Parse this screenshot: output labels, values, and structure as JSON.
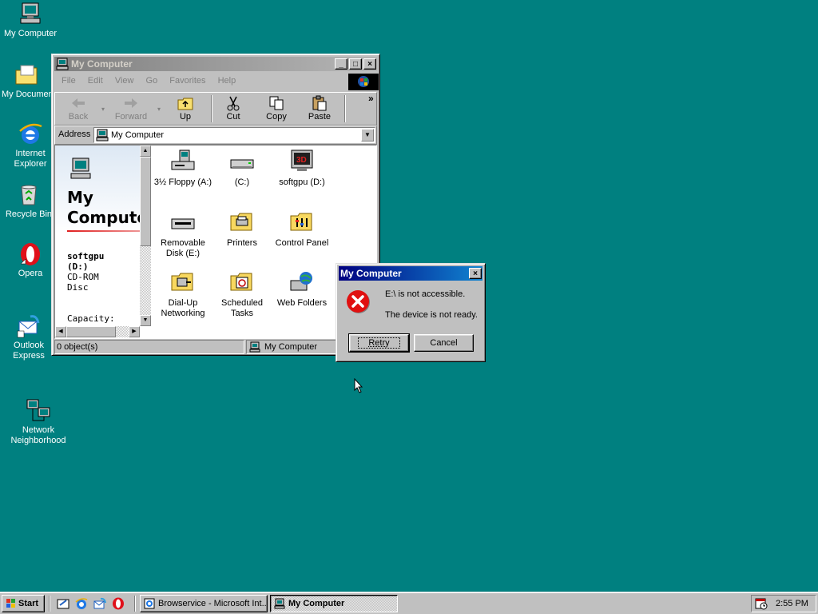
{
  "desktop": {
    "icons": [
      {
        "label": "My Computer"
      },
      {
        "label": "My Documents"
      },
      {
        "label": "Internet Explorer"
      },
      {
        "label": "Recycle Bin"
      },
      {
        "label": "Opera"
      },
      {
        "label": "Outlook Express"
      },
      {
        "label": "Network Neighborhood"
      }
    ]
  },
  "explorer": {
    "title": "My Computer",
    "menu": [
      "File",
      "Edit",
      "View",
      "Go",
      "Favorites",
      "Help"
    ],
    "toolbar": {
      "back": "Back",
      "forward": "Forward",
      "up": "Up",
      "cut": "Cut",
      "copy": "Copy",
      "paste": "Paste",
      "more": "»"
    },
    "address": {
      "label": "Address",
      "value": "My Computer"
    },
    "left_panel": {
      "title": "My Computer",
      "selected_name": "softgpu (D:)",
      "selected_type": "CD-ROM Disc",
      "capacity_label": "Capacity:"
    },
    "items": [
      {
        "label": "3½ Floppy (A:)"
      },
      {
        "label": "(C:)"
      },
      {
        "label": "softgpu (D:)"
      },
      {
        "label": "Removable Disk (E:)"
      },
      {
        "label": "Printers"
      },
      {
        "label": "Control Panel"
      },
      {
        "label": "Dial-Up Networking"
      },
      {
        "label": "Scheduled Tasks"
      },
      {
        "label": "Web Folders"
      }
    ],
    "status": {
      "left": "0 object(s)",
      "right": "My Computer"
    }
  },
  "dialog": {
    "title": "My Computer",
    "line1": "E:\\ is not accessible.",
    "line2": "The device is not ready.",
    "retry": "Retry",
    "cancel": "Cancel"
  },
  "taskbar": {
    "start": "Start",
    "tasks": [
      {
        "label": "Browservice - Microsoft Int..."
      },
      {
        "label": "My Computer"
      }
    ],
    "clock": "2:55 PM"
  },
  "colors": {
    "desktop": "#008080",
    "title_active": "#000080",
    "error": "#e01010"
  }
}
